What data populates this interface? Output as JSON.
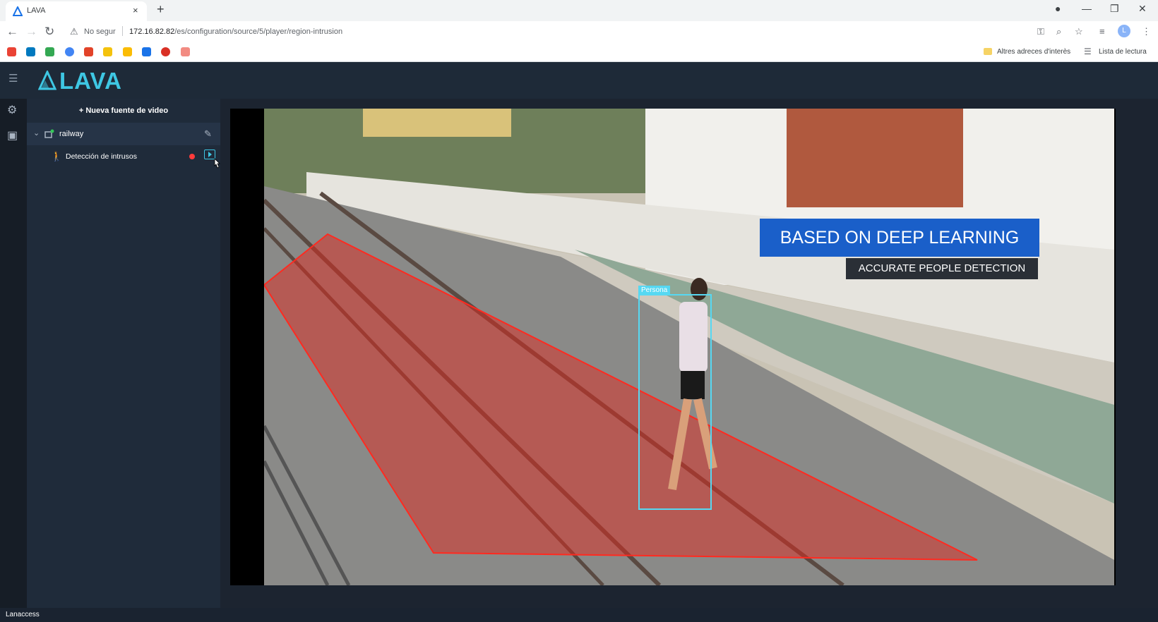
{
  "browser": {
    "tab_title": "LAVA",
    "tab_close": "×",
    "new_tab": "+",
    "back": "←",
    "forward": "→",
    "reload": "↻",
    "security_label": "No segur",
    "url_host": "172.16.82.82",
    "url_path": "/es/configuration/source/5/player/region-intrusion",
    "bookmarks_folder_label": "Altres adreces d'interès",
    "reading_list_label": "Lista de lectura",
    "profile_initial": "L"
  },
  "app": {
    "logo_text": "LAVA",
    "accent_color": "#3ec7e3"
  },
  "sidebar": {
    "new_source_label": "+ Nueva fuente de video",
    "source": {
      "label": "railway"
    },
    "player": {
      "label": "Detección de intrusos"
    }
  },
  "video": {
    "overlay_title": "BASED ON DEEP LEARNING",
    "overlay_subtitle": "ACCURATE PEOPLE DETECTION",
    "detection_label": "Persona",
    "region_color": "#e02a20"
  },
  "statusbar": {
    "text": "Lanaccess"
  }
}
